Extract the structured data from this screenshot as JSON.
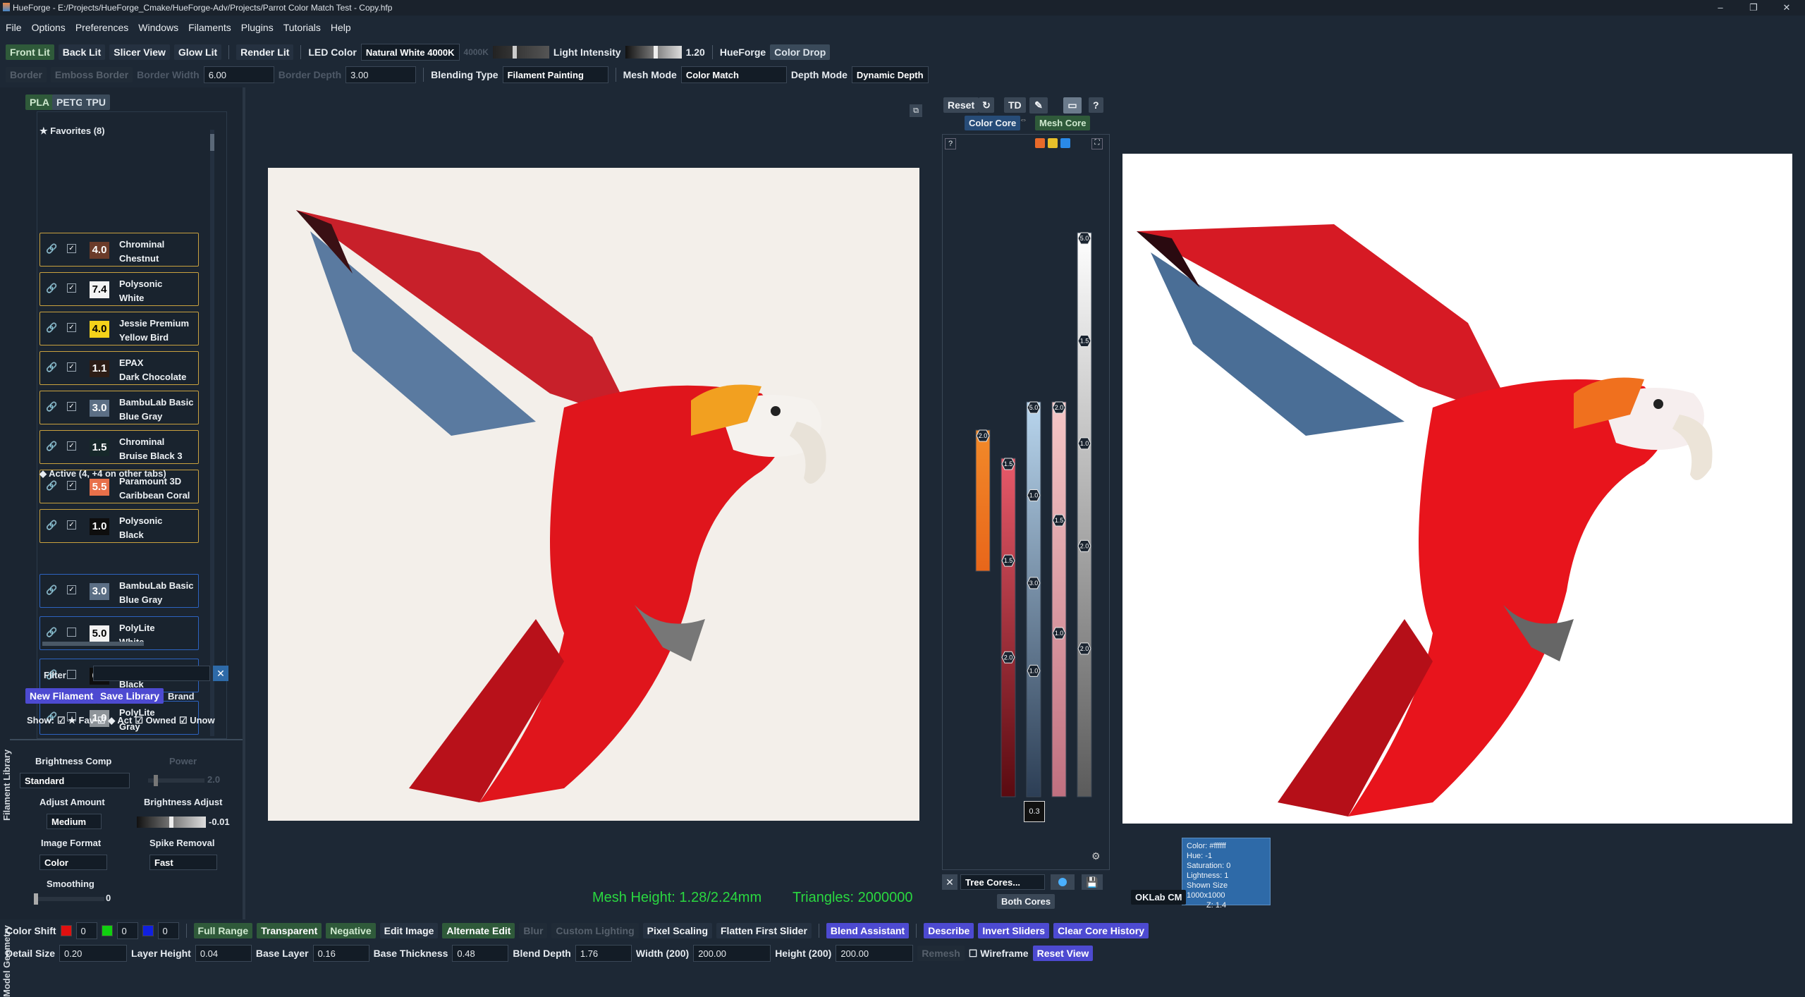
{
  "window": {
    "title": "HueForge - E:/Projects/HueForge_Cmake/HueForge-Adv/Projects/Parrot Color Match Test - Copy.hfp",
    "minimize": "–",
    "maximize": "❐",
    "close": "✕"
  },
  "menu": [
    "File",
    "Options",
    "Preferences",
    "Windows",
    "Filaments",
    "Plugins",
    "Tutorials",
    "Help"
  ],
  "toolbar1": {
    "front_lit": "Front Lit",
    "back_lit": "Back Lit",
    "slicer_view": "Slicer View",
    "glow_lit": "Glow Lit",
    "render_lit": "Render Lit",
    "led_color_label": "LED Color",
    "led_color_value": "Natural White 4000K",
    "led_temp": "4000K",
    "light_intensity_label": "Light Intensity",
    "light_intensity_value": "1.20",
    "light_intensity_fraction": 0.55,
    "hueforge": "HueForge",
    "color_drop": "Color Drop"
  },
  "toolbar2": {
    "border": "Border",
    "emboss": "Emboss Border",
    "border_width_label": "Border Width",
    "border_width": "6.00",
    "border_depth_label": "Border Depth",
    "border_depth": "3.00",
    "blending_type_label": "Blending Type",
    "blending_type": "Filament Painting",
    "mesh_mode_label": "Mesh Mode",
    "mesh_mode": "Color Match",
    "depth_mode_label": "Depth Mode",
    "depth_mode": "Dynamic Depth"
  },
  "library": {
    "tabs": [
      "PLA",
      "PETG",
      "TPU"
    ],
    "favorites_header": "Favorites (8)",
    "active_header": "Active (4, +4 on other tabs)",
    "favorites": [
      {
        "td": "4.0",
        "name1": "Chrominal",
        "name2": "Chestnut",
        "color": "#6b3b2a",
        "text": "#ffffff"
      },
      {
        "td": "7.4",
        "name1": "Polysonic",
        "name2": "White",
        "color": "#f2f2f2",
        "text": "#000000"
      },
      {
        "td": "4.0",
        "name1": "Jessie Premium",
        "name2": "Yellow Bird",
        "color": "#f4d21a",
        "text": "#000000"
      },
      {
        "td": "1.1",
        "name1": "EPAX",
        "name2": "Dark Chocolate",
        "color": "#2d1d16",
        "text": "#ffffff"
      },
      {
        "td": "3.0",
        "name1": "BambuLab Basic",
        "name2": "Blue Gray",
        "color": "#5c6f85",
        "text": "#ffffff"
      },
      {
        "td": "1.5",
        "name1": "Chrominal",
        "name2": "Bruise Black 3",
        "color": "#16282a",
        "text": "#ffffff"
      },
      {
        "td": "5.5",
        "name1": "Paramount 3D",
        "name2": "Caribbean Coral",
        "color": "#e8704a",
        "text": "#ffffff"
      },
      {
        "td": "1.0",
        "name1": "Polysonic",
        "name2": "Black",
        "color": "#0e0e0e",
        "text": "#ffffff"
      }
    ],
    "active": [
      {
        "td": "3.0",
        "name1": "BambuLab Basic",
        "name2": "Blue Gray",
        "color": "#5c6f85",
        "text": "#ffffff",
        "checked": true
      },
      {
        "td": "5.0",
        "name1": "PolyLite",
        "name2": "White",
        "color": "#f2f2f2",
        "text": "#000000",
        "checked": false
      },
      {
        "td": "0.3",
        "name1": "PolyLite",
        "name2": "Black",
        "color": "#0e0e0e",
        "text": "#ffffff",
        "checked": false
      },
      {
        "td": "1.0",
        "name1": "PolyLite",
        "name2": "Gray",
        "color": "#8e9499",
        "text": "#ffffff",
        "checked": false
      }
    ],
    "filter_label": "Filter",
    "new_filament": "New Filament",
    "save_library": "Save Library",
    "brand": "Brand",
    "show_label": "Show:",
    "show_fav": "Fav",
    "show_act": "Act",
    "show_owned": "Owned",
    "show_unowned": "Unow",
    "side_title": "Filament Library"
  },
  "geometry": {
    "side_title": "Model Geometry",
    "brightness_comp": "Brightness Comp",
    "power": "Power",
    "standard": "Standard",
    "power_value": "2.0",
    "adjust_amount": "Adjust Amount",
    "brightness_adjust": "Brightness Adjust",
    "medium": "Medium",
    "brightness_value": "-0.01",
    "image_format": "Image Format",
    "spike_removal": "Spike Removal",
    "color": "Color",
    "fast": "Fast",
    "smoothing": "Smoothing",
    "smoothing_value": "0"
  },
  "sliders": {
    "reset": "Reset",
    "td": "TD",
    "help": "?",
    "color_core": "Color Core",
    "mesh_core": "Mesh Core",
    "tree_cores": "Tree Cores...",
    "both_cores": "Both Cores",
    "oklab": "OKLab CM",
    "columns": [
      {
        "top_val": "2.0",
        "marks": [
          "2.0"
        ],
        "color_top": "#f28a2a",
        "color_bot": "#e8661a"
      },
      {
        "top_val": "1.5",
        "marks": [
          "1.5",
          "1.5",
          "2.0"
        ],
        "color_top": "#e85a6a",
        "color_bot": "#5a0a10"
      },
      {
        "top_val": "5.0",
        "marks": [
          "5.0",
          "1.0",
          "3.0",
          "1.0"
        ],
        "color_top": "#b9d6ee",
        "color_bot": "#2c3e55"
      },
      {
        "top_val": "2.0",
        "marks": [
          "2.0",
          "1.5",
          "1.0"
        ],
        "color_top": "#f5c7c7",
        "color_bot": "#c07080"
      },
      {
        "top_val": "5.0",
        "marks": [
          "5.0",
          "1.5",
          "1.0",
          "2.0",
          "2.0"
        ],
        "color_top": "#ffffff",
        "color_bot": "#5b5b5b"
      }
    ],
    "bottom_val": "0.3"
  },
  "tooltip": {
    "color": "Color: #ffffff",
    "hue": "Hue: -1",
    "saturation": "Saturation: 0",
    "lightness": "Lightness: 1",
    "shown_size": "Shown Size 1000x1000",
    "z": "Z: 1.4"
  },
  "status": {
    "mesh_height": "Mesh Height: 1.28/2.24mm",
    "triangles": "Triangles: 2000000"
  },
  "bottom1": {
    "color_shift": "Color Shift",
    "r": "0",
    "g": "0",
    "b": "0",
    "full_range": "Full Range",
    "transparent": "Transparent",
    "negative": "Negative",
    "edit_image": "Edit Image",
    "alternate_edit": "Alternate Edit",
    "blur": "Blur",
    "custom_lighting": "Custom Lighting",
    "pixel_scaling": "Pixel Scaling",
    "flatten": "Flatten First Slider",
    "blend_assistant": "Blend Assistant",
    "describe": "Describe",
    "invert_sliders": "Invert Sliders",
    "clear_core": "Clear Core History",
    "colors": {
      "r": "#e01010",
      "g": "#10d010",
      "b": "#1020e0"
    }
  },
  "bottom2": {
    "detail_size_label": "Detail Size",
    "detail_size": "0.20",
    "layer_height_label": "Layer Height",
    "layer_height": "0.04",
    "base_layer_label": "Base Layer",
    "base_layer": "0.16",
    "base_thickness_label": "Base Thickness",
    "base_thickness": "0.48",
    "blend_depth_label": "Blend Depth",
    "blend_depth": "1.76",
    "width_label": "Width (200)",
    "width": "200.00",
    "height_label": "Height (200)",
    "height": "200.00",
    "remesh": "Remesh",
    "wireframe": "Wireframe",
    "reset_view": "Reset View"
  }
}
